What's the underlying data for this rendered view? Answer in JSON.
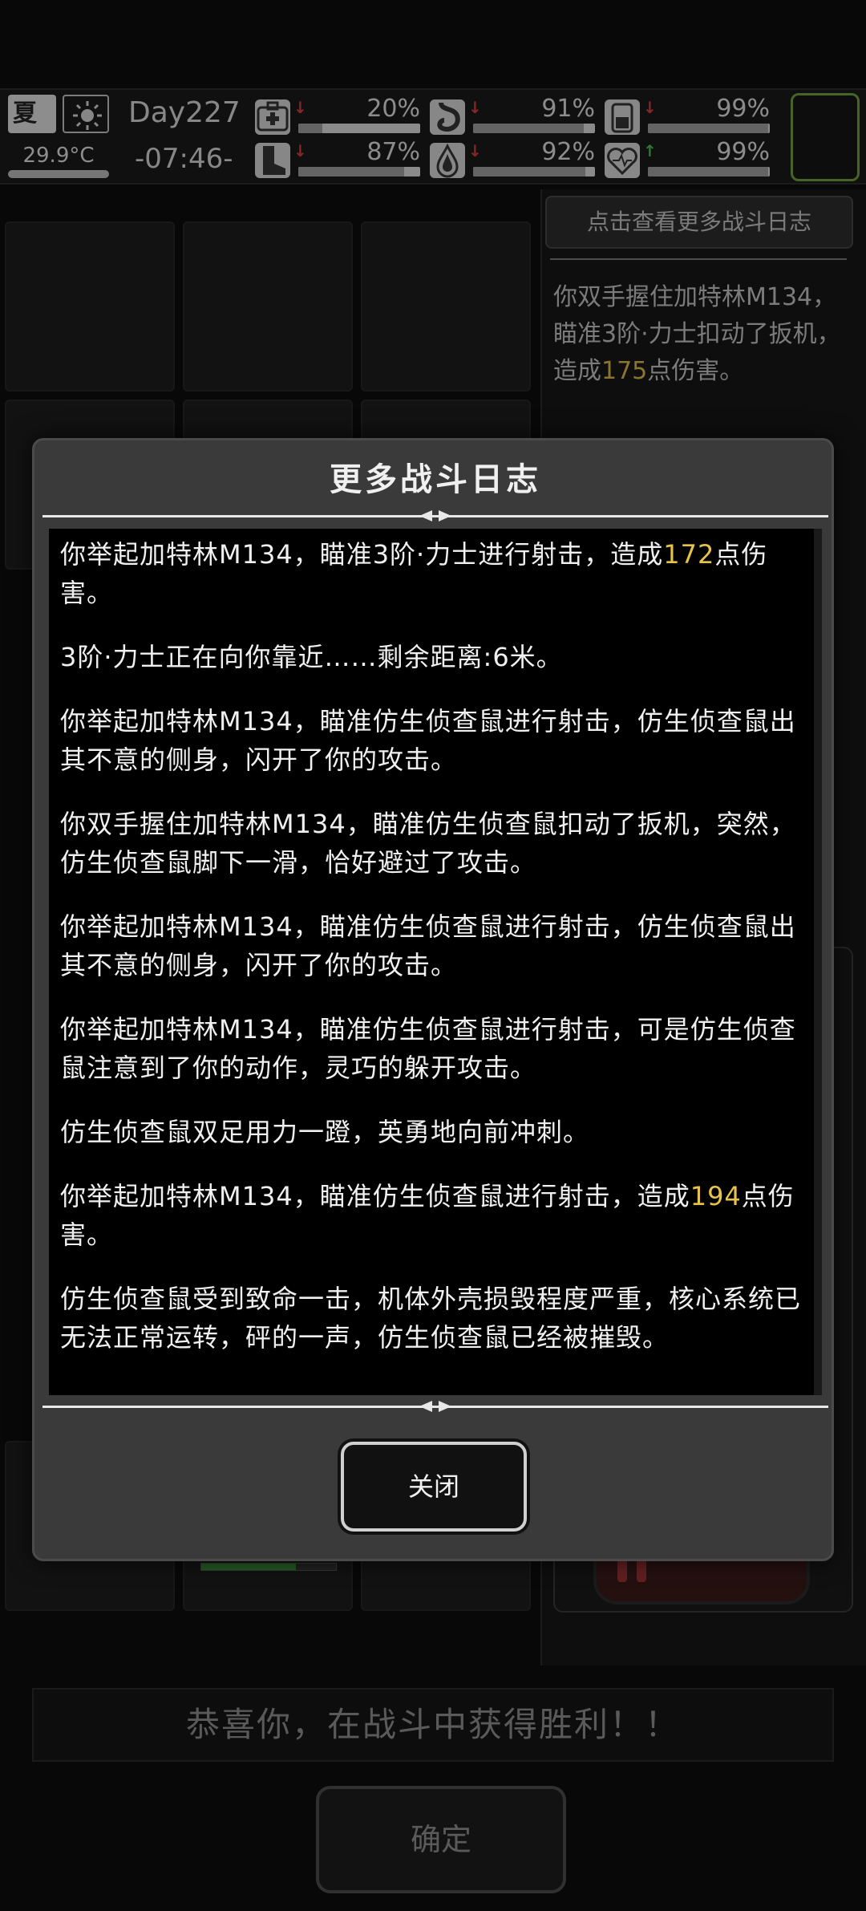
{
  "status_bar": {
    "season": "夏",
    "temperature": "29.9°C",
    "day": "Day227",
    "time": "-07:46-",
    "stats": [
      {
        "icon": "medkit-icon",
        "trend": "down",
        "value": "20%",
        "level": 0.2
      },
      {
        "icon": "stomach-icon",
        "trend": "down",
        "value": "91%",
        "level": 0.91
      },
      {
        "icon": "battery-icon",
        "trend": "down",
        "value": "99%",
        "level": 0.99
      },
      {
        "icon": "boot-icon",
        "trend": "down",
        "value": "87%",
        "level": 0.87
      },
      {
        "icon": "water-drop-icon",
        "trend": "down",
        "value": "92%",
        "level": 0.92
      },
      {
        "icon": "heart-icon",
        "trend": "up",
        "value": "99%",
        "level": 0.99
      }
    ]
  },
  "side_panel": {
    "more_log_button": "点击查看更多战斗日志",
    "log_preview": [
      {
        "text": "你双手握住加特林M134，瞄准3阶·力士扣动了扳机，造成"
      },
      {
        "num": "175"
      },
      {
        "text": "点伤害。"
      }
    ]
  },
  "modal": {
    "title": "更多战斗日志",
    "entries": [
      [
        {
          "text": "你举起加特林M134，瞄准3阶·力士进行射击，造成"
        },
        {
          "num": "172"
        },
        {
          "text": "点伤害。"
        }
      ],
      [
        {
          "text": "3阶·力士正在向你靠近……剩余距离:6米。"
        }
      ],
      [
        {
          "text": "你举起加特林M134，瞄准仿生侦查鼠进行射击，仿生侦查鼠出其不意的侧身，闪开了你的攻击。"
        }
      ],
      [
        {
          "text": "你双手握住加特林M134，瞄准仿生侦查鼠扣动了扳机，突然，仿生侦查鼠脚下一滑，恰好避过了攻击。"
        }
      ],
      [
        {
          "text": "你举起加特林M134，瞄准仿生侦查鼠进行射击，仿生侦查鼠出其不意的侧身，闪开了你的攻击。"
        }
      ],
      [
        {
          "text": "你举起加特林M134，瞄准仿生侦查鼠进行射击，可是仿生侦查鼠注意到了你的动作，灵巧的躲开攻击。"
        }
      ],
      [
        {
          "text": "仿生侦查鼠双足用力一蹬，英勇地向前冲刺。"
        }
      ],
      [
        {
          "text": "你举起加特林M134，瞄准仿生侦查鼠进行射击，造成"
        },
        {
          "num": "194"
        },
        {
          "text": "点伤害。"
        }
      ],
      [
        {
          "text": "仿生侦查鼠受到致命一击，机体外壳损毁程度严重，核心系统已无法正常运转，砰的一声，仿生侦查鼠已经被摧毁。"
        }
      ]
    ],
    "close_label": "关闭"
  },
  "footer": {
    "victory_text": "恭喜你，在战斗中获得胜利！！",
    "confirm_label": "确定"
  },
  "colors": {
    "highlight_number": "#e8c34a",
    "down_arrow": "#d23a3a",
    "up_arrow": "#3fbf4a",
    "slot_border": "#6b9a3a"
  }
}
